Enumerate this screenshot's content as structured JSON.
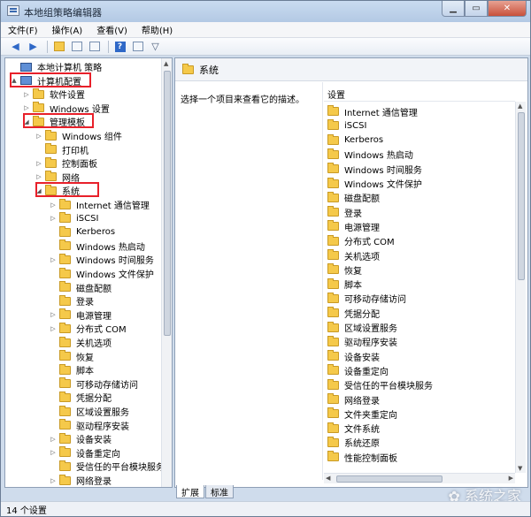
{
  "window": {
    "title": "本地组策略编辑器"
  },
  "menu": [
    "文件(F)",
    "操作(A)",
    "查看(V)",
    "帮助(H)"
  ],
  "tree": [
    {
      "label": "本地计算机 策略",
      "level": 0,
      "exp": "",
      "icon": "computer-icon"
    },
    {
      "label": "计算机配置",
      "level": 0,
      "exp": "▲",
      "icon": "computer-icon"
    },
    {
      "label": "软件设置",
      "level": 1,
      "exp": "▷"
    },
    {
      "label": "Windows 设置",
      "level": 1,
      "exp": "▷"
    },
    {
      "label": "管理模板",
      "level": 1,
      "exp": "◢"
    },
    {
      "label": "Windows 组件",
      "level": 2,
      "exp": "▷"
    },
    {
      "label": "打印机",
      "level": 2,
      "exp": ""
    },
    {
      "label": "控制面板",
      "level": 2,
      "exp": "▷"
    },
    {
      "label": "网络",
      "level": 2,
      "exp": "▷"
    },
    {
      "label": "系统",
      "level": 2,
      "exp": "◢"
    },
    {
      "label": "Internet 通信管理",
      "level": 3,
      "exp": "▷"
    },
    {
      "label": "iSCSI",
      "level": 3,
      "exp": "▷"
    },
    {
      "label": "Kerberos",
      "level": 3,
      "exp": ""
    },
    {
      "label": "Windows 热启动",
      "level": 3,
      "exp": ""
    },
    {
      "label": "Windows 时间服务",
      "level": 3,
      "exp": "▷"
    },
    {
      "label": "Windows 文件保护",
      "level": 3,
      "exp": ""
    },
    {
      "label": "磁盘配额",
      "level": 3,
      "exp": ""
    },
    {
      "label": "登录",
      "level": 3,
      "exp": ""
    },
    {
      "label": "电源管理",
      "level": 3,
      "exp": "▷"
    },
    {
      "label": "分布式 COM",
      "level": 3,
      "exp": "▷"
    },
    {
      "label": "关机选项",
      "level": 3,
      "exp": ""
    },
    {
      "label": "恢复",
      "level": 3,
      "exp": ""
    },
    {
      "label": "脚本",
      "level": 3,
      "exp": ""
    },
    {
      "label": "可移动存储访问",
      "level": 3,
      "exp": ""
    },
    {
      "label": "凭据分配",
      "level": 3,
      "exp": ""
    },
    {
      "label": "区域设置服务",
      "level": 3,
      "exp": ""
    },
    {
      "label": "驱动程序安装",
      "level": 3,
      "exp": ""
    },
    {
      "label": "设备安装",
      "level": 3,
      "exp": "▷"
    },
    {
      "label": "设备重定向",
      "level": 3,
      "exp": "▷"
    },
    {
      "label": "受信任的平台模块服务",
      "level": 3,
      "exp": ""
    },
    {
      "label": "网络登录",
      "level": 3,
      "exp": "▷"
    }
  ],
  "right": {
    "header": "系统",
    "description": "选择一个项目来查看它的描述。",
    "column": "设置",
    "items": [
      "Internet 通信管理",
      "iSCSI",
      "Kerberos",
      "Windows 热启动",
      "Windows 时间服务",
      "Windows 文件保护",
      "磁盘配额",
      "登录",
      "电源管理",
      "分布式 COM",
      "关机选项",
      "恢复",
      "脚本",
      "可移动存储访问",
      "凭据分配",
      "区域设置服务",
      "驱动程序安装",
      "设备安装",
      "设备重定向",
      "受信任的平台模块服务",
      "网络登录",
      "文件夹重定向",
      "文件系统",
      "系统还原",
      "性能控制面板"
    ]
  },
  "tabs": [
    "扩展",
    "标准"
  ],
  "status": "14 个设置",
  "watermark": "系统之家",
  "colors": {
    "highlight": "#e8202a",
    "folder": "#f5c94a"
  }
}
